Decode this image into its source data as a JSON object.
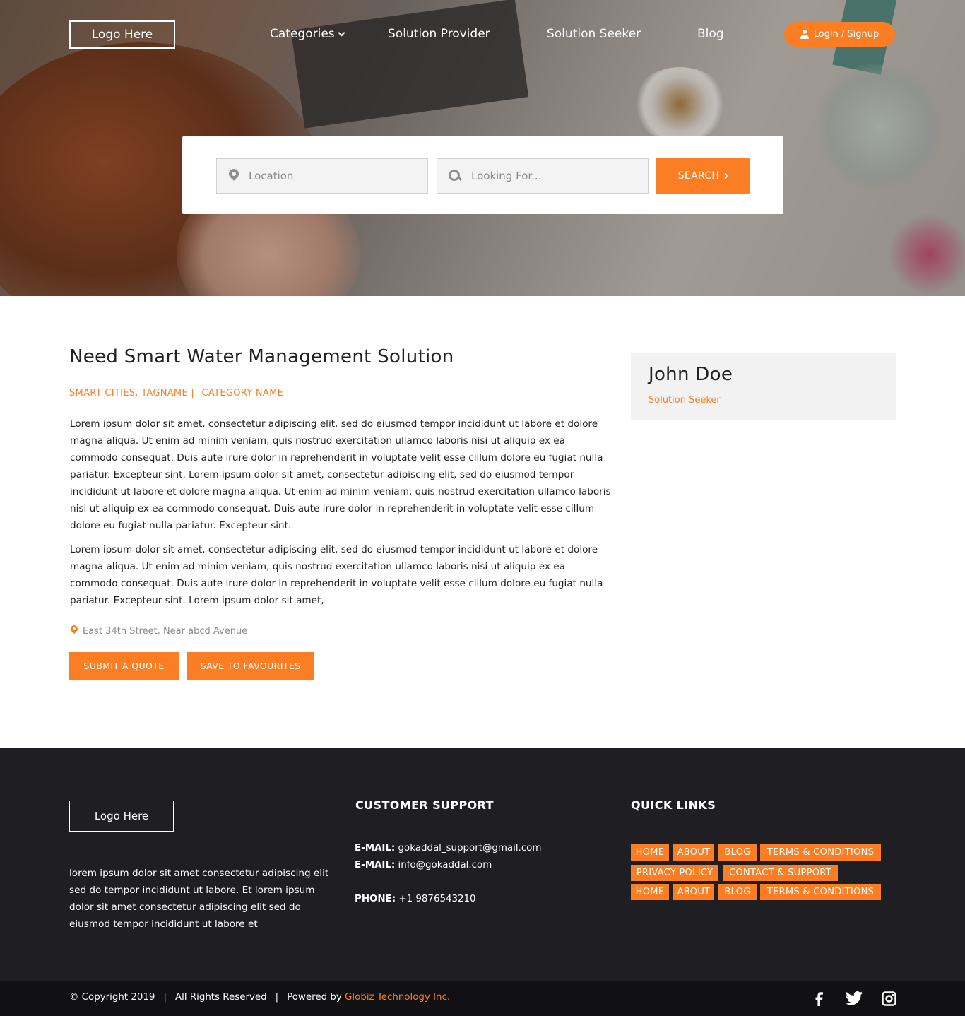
{
  "header": {
    "logo": "Logo Here",
    "nav": [
      "Categories",
      "Solution Provider",
      "Solution Seeker",
      "Blog"
    ],
    "login": "Login / Signup"
  },
  "search": {
    "location_placeholder": "Location",
    "looking_placeholder": "Looking For...",
    "button": "SEARCH"
  },
  "post": {
    "title": "Need Smart Water Management Solution",
    "tags": "SMART CITIES, TAGNAME |",
    "category": "CATEGORY NAME",
    "paragraphs": [
      "Lorem ipsum dolor sit amet, consectetur adipiscing elit, sed do eiusmod tempor incididunt ut labore et dolore magna aliqua. Ut enim ad minim veniam, quis nostrud exercitation ullamco laboris nisi ut aliquip ex ea commodo consequat. Duis aute irure dolor in reprehenderit in voluptate velit esse cillum dolore eu fugiat nulla pariatur. Excepteur sint. Lorem ipsum dolor sit amet, consectetur adipiscing elit, sed do eiusmod tempor incididunt ut labore et dolore magna aliqua. Ut enim ad minim veniam, quis nostrud exercitation ullamco laboris nisi ut aliquip ex ea commodo consequat. Duis aute irure dolor in reprehenderit in voluptate velit esse cillum dolore eu fugiat nulla pariatur. Excepteur sint.",
      "Lorem ipsum dolor sit amet, consectetur adipiscing elit, sed do eiusmod tempor incididunt ut labore et dolore magna aliqua. Ut enim ad minim veniam, quis nostrud exercitation ullamco laboris nisi ut aliquip ex ea commodo consequat. Duis aute irure dolor in reprehenderit in voluptate velit esse cillum dolore eu fugiat nulla pariatur. Excepteur sint. Lorem ipsum dolor sit amet,"
    ],
    "address": "East 34th Street, Near abcd Avenue",
    "submit_quote": "SUBMIT A QUOTE",
    "save_favourites": "SAVE TO FAVOURITES"
  },
  "profile": {
    "name": "John Doe",
    "role": "Solution Seeker"
  },
  "footer": {
    "logo": "Logo Here",
    "about": "lorem ipsum dolor sit amet consectetur adipiscing elit sed do tempor incididunt ut labore.  Et lorem ipsum dolor sit amet consectetur adipiscing elit sed do eiusmod tempor incididunt ut labore et",
    "support_heading": "CUSTOMER SUPPORT",
    "email_label": "E-MAIL:",
    "email1": "gokaddal_support@gmail.com",
    "email2": "info@gokaddal.com",
    "phone_label": "PHONE:",
    "phone": "+1 9876543210",
    "quick_heading": "QUICK LINKS",
    "quick_links": [
      "HOME",
      "ABOUT",
      "BLOG",
      "TERMS & CONDITIONS",
      "PRIVACY POLICY",
      "CONTACT & SUPPORT",
      "HOME",
      "ABOUT",
      "BLOG",
      "TERMS & CONDITIONS"
    ]
  },
  "bottom": {
    "copyright": "© Copyright 2019",
    "rights": "All Rights Reserved",
    "powered": "Powered by",
    "brand": "Globiz Technology Inc.",
    "social": [
      "facebook-icon",
      "twitter-icon",
      "instagram-icon"
    ]
  },
  "colors": {
    "accent": "#fb7e24",
    "footer_bg": "#1f1f23",
    "bottom_bg": "#111114",
    "card_bg": "#f2f2f2"
  }
}
